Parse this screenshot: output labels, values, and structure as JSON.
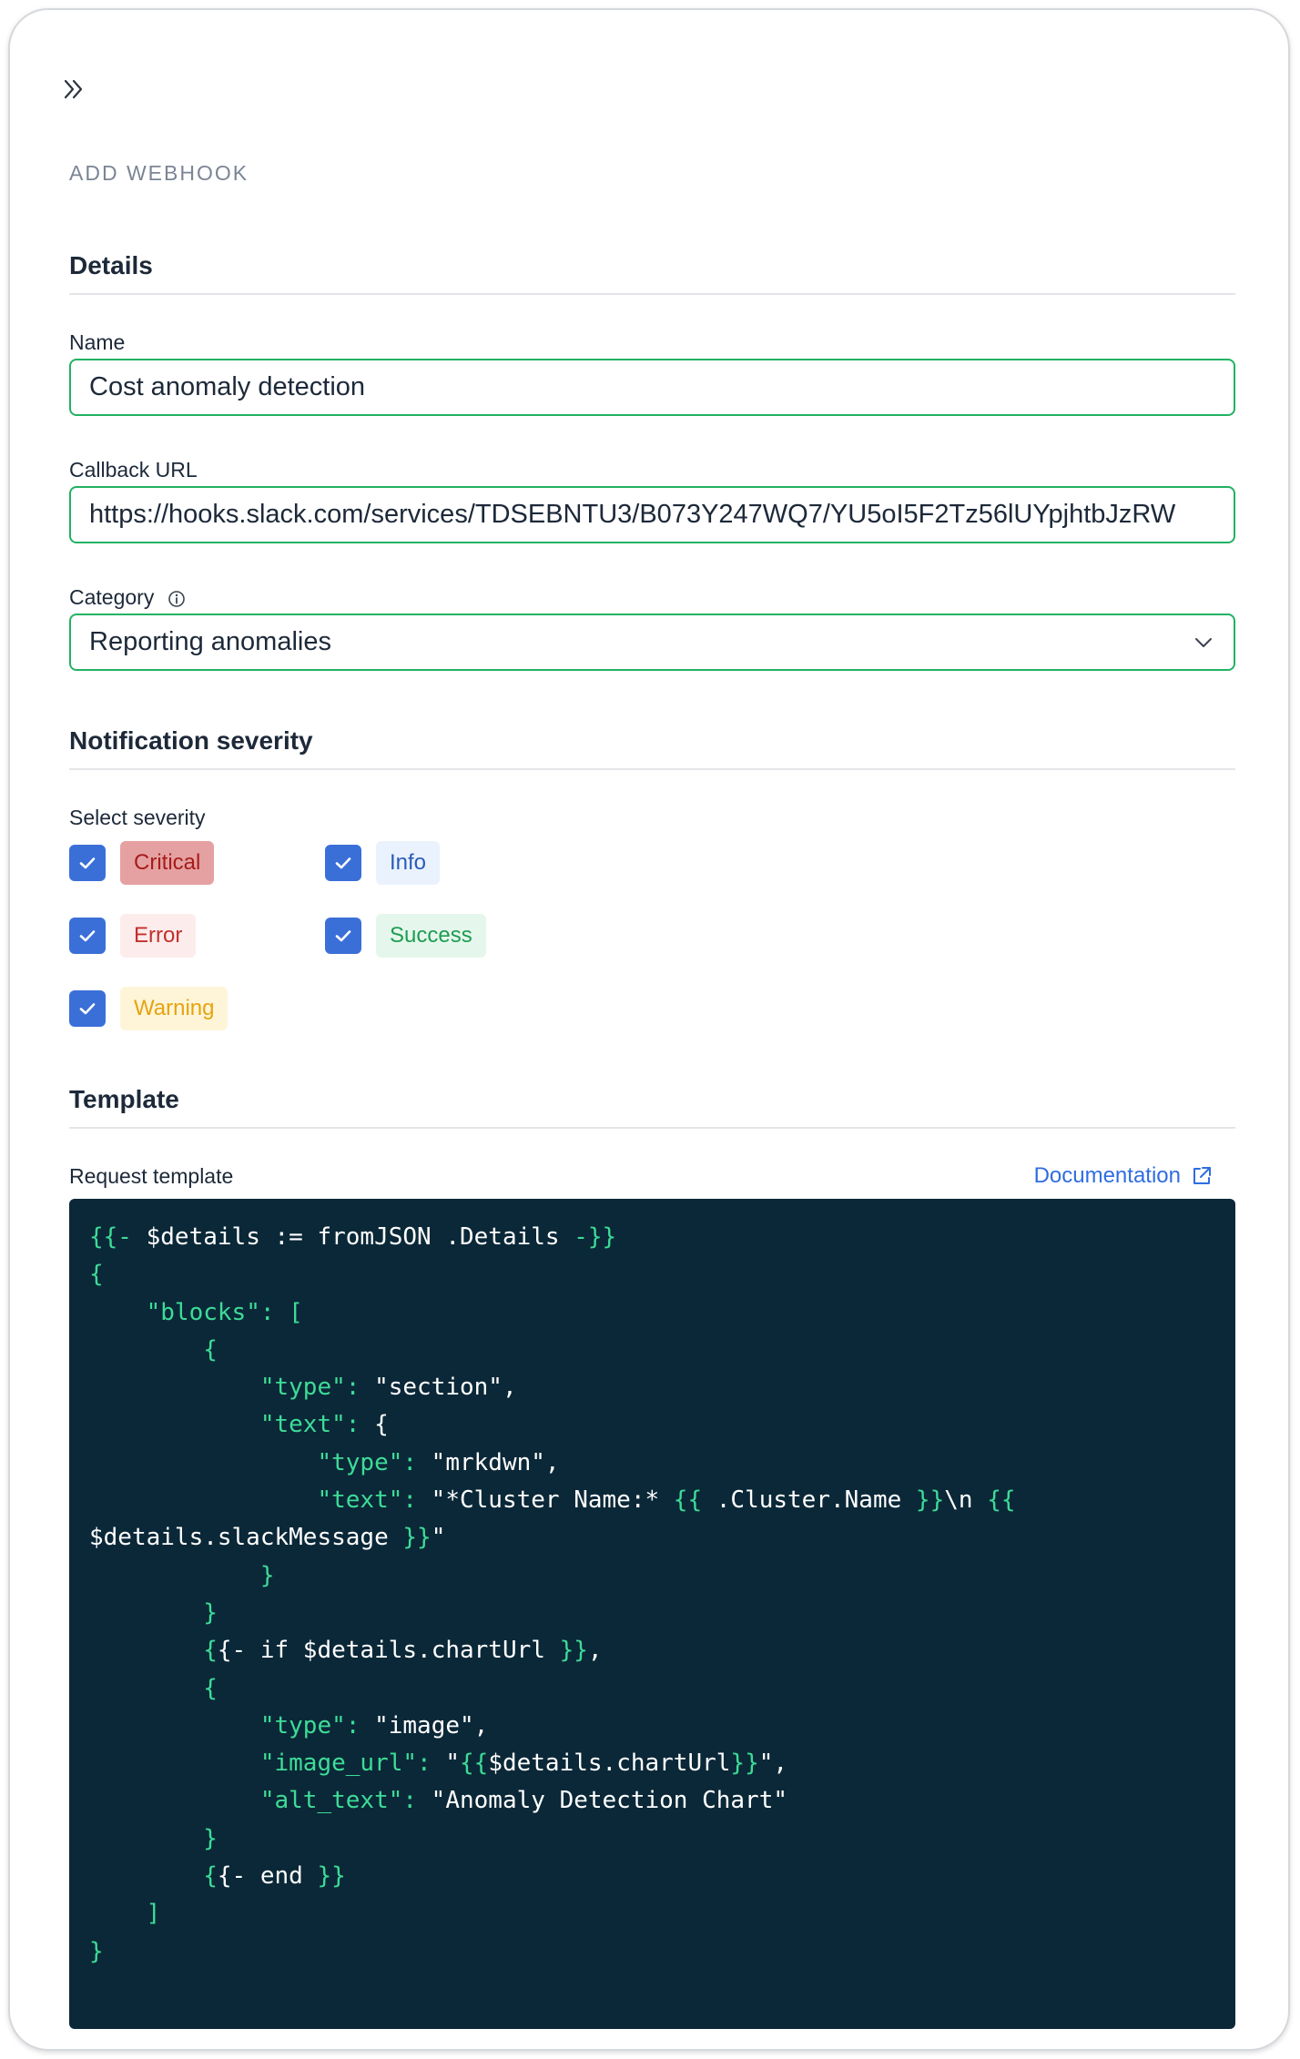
{
  "page_title": "ADD WEBHOOK",
  "sections": {
    "details": "Details",
    "severity": "Notification severity",
    "template": "Template"
  },
  "fields": {
    "name_label": "Name",
    "name_value": "Cost anomaly detection",
    "callback_label": "Callback URL",
    "callback_value": "https://hooks.slack.com/services/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",
    "category_label": "Category",
    "category_value": "Reporting anomalies"
  },
  "severity": {
    "label": "Select severity",
    "levels": [
      {
        "label": "Critical",
        "checked": true
      },
      {
        "label": "Error",
        "checked": true
      },
      {
        "label": "Warning",
        "checked": true
      },
      {
        "label": "Info",
        "checked": true
      },
      {
        "label": "Success",
        "checked": true
      }
    ]
  },
  "template": {
    "label": "Request template",
    "doc_link": "Documentation",
    "code_lines": [
      "{{- $details := fromJSON .Details -}}",
      "{",
      "    \"blocks\": [",
      "        {",
      "            \"type\": \"section\",",
      "            \"text\": {",
      "                \"type\": \"mrkdwn\",",
      "                \"text\": \"*Cluster Name:* {{ .Cluster.Name }}\\n {{ $details.slackMessage }}\"",
      "            }",
      "        }",
      "        {{- if $details.chartUrl }},",
      "        {",
      "            \"type\": \"image\",",
      "            \"image_url\": \"{{$details.chartUrl}}\",",
      "            \"alt_text\": \"Anomaly Detection Chart\"",
      "        }",
      "        {{- end }}",
      "    ]",
      "}"
    ]
  },
  "colors": {
    "accent_green": "#22b262",
    "checkbox_blue": "#3b6fd8",
    "code_background": "#0b2838",
    "code_syntax": "#3ddc97",
    "link_blue": "#2f6de1"
  },
  "icons": {
    "collapse": "double-chevron-right-icon",
    "info": "info-circle-icon",
    "dropdown": "chevron-down-icon",
    "check": "check-icon",
    "external": "external-link-icon"
  }
}
